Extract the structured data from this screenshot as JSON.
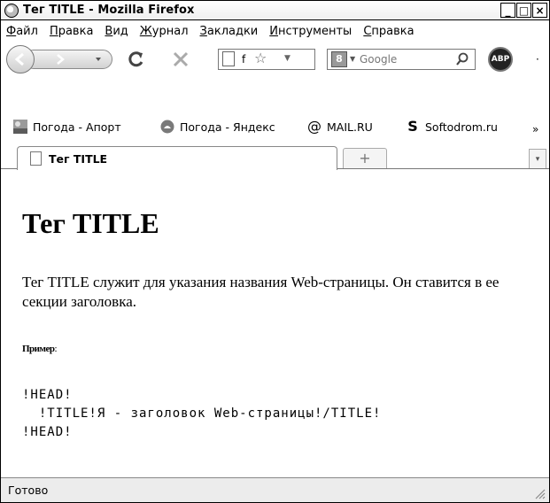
{
  "window": {
    "title": "Тег TITLE - Mozilla Firefox",
    "controls": {
      "minimize": "_",
      "maximize": "□",
      "close": "×"
    }
  },
  "menu": {
    "items": [
      {
        "mnemonic": "Ф",
        "rest": "айл"
      },
      {
        "mnemonic": "П",
        "rest": "равка"
      },
      {
        "mnemonic": "В",
        "rest": "ид"
      },
      {
        "mnemonic": "Ж",
        "rest": "урнал"
      },
      {
        "mnemonic": "З",
        "rest": "акладки"
      },
      {
        "mnemonic": "И",
        "rest": "нструменты"
      },
      {
        "mnemonic": "С",
        "rest": "правка"
      }
    ]
  },
  "navbar": {
    "url_text": "f",
    "search_placeholder": "Google",
    "search_engine_label": "8",
    "adblock_label": "ABP"
  },
  "bookmarks": [
    {
      "label": "Погода - Апорт",
      "icon": "weather-icon"
    },
    {
      "label": "Погода - Яндекс",
      "icon": "yandex-weather-icon"
    },
    {
      "label": "MAIL.RU",
      "icon": "at-icon"
    },
    {
      "label": "Softodrom.ru",
      "icon": "softodrom-icon"
    }
  ],
  "bookmarks_more": "»",
  "tabs": {
    "active_title": "Тег TITLE",
    "new_tab_symbol": "+",
    "list_symbol": "▾"
  },
  "page": {
    "heading": "Тег TITLE",
    "paragraph": "Тег TITLE служит для указания названия Web-страницы. Он ставится в ее секции заголовка.",
    "example_label": "Пример",
    "example_colon": ":",
    "code_lines": [
      "!HEAD!",
      "  !TITLE!Я - заголовок Web-страницы!/TITLE!",
      "!HEAD!"
    ]
  },
  "status": {
    "text": "Готово"
  }
}
